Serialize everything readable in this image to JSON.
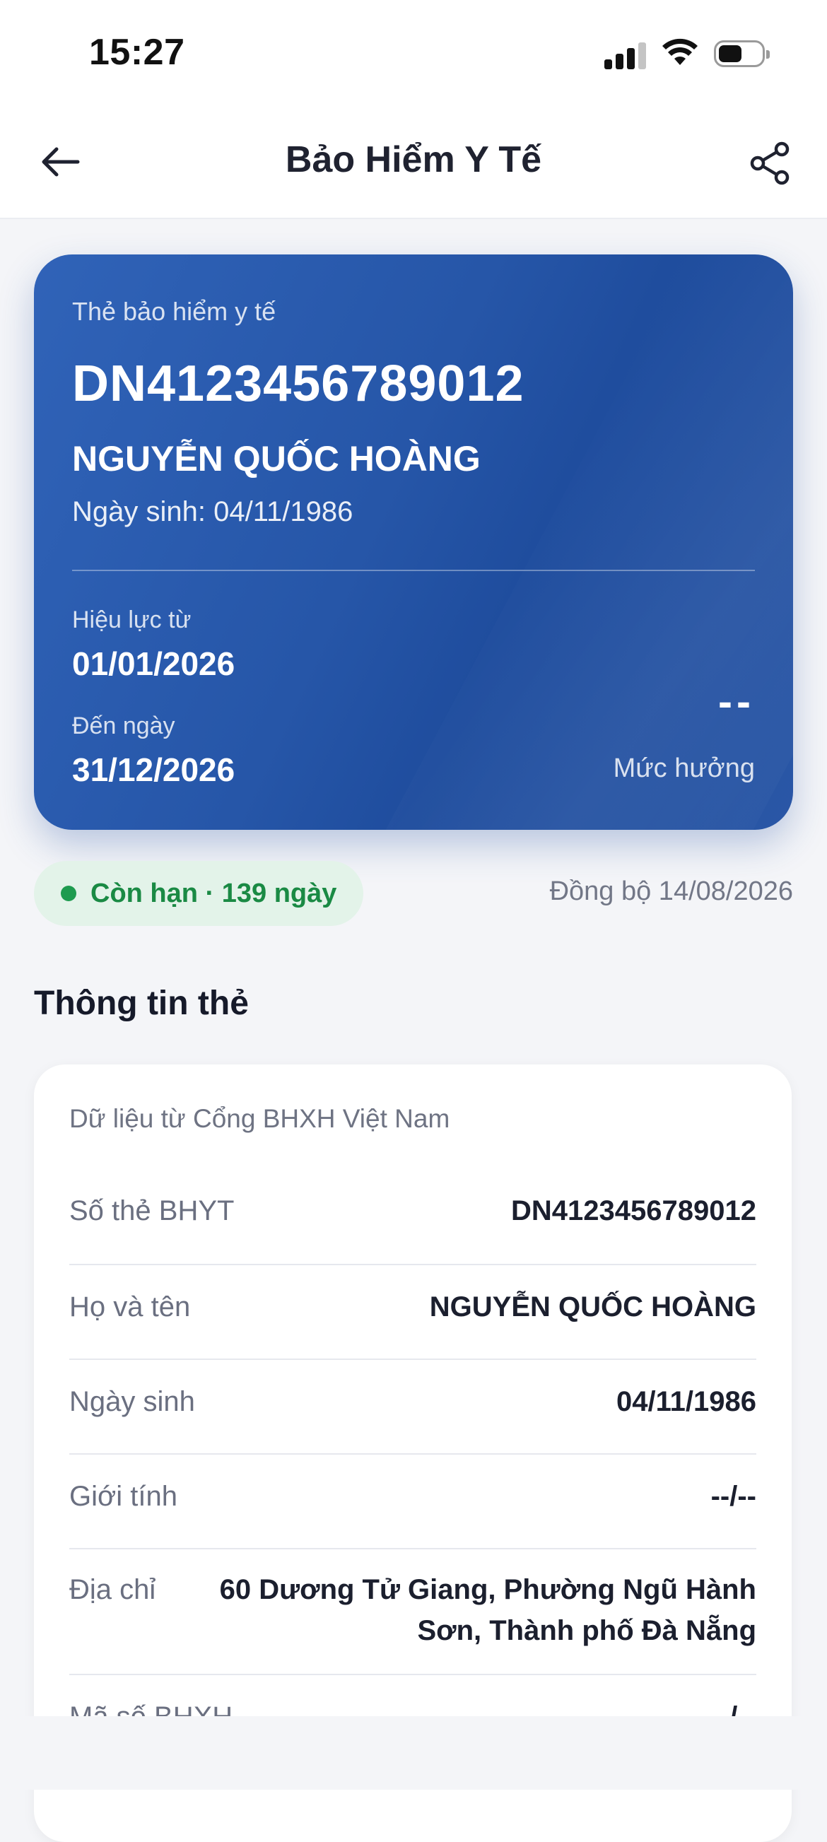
{
  "status_bar": {
    "time": "15:27"
  },
  "header": {
    "title": "Bảo Hiểm Y Tế"
  },
  "card": {
    "label": "Thẻ bảo hiểm y tế",
    "number": "DN4123456789012",
    "name": "NGUYỄN QUỐC HOÀNG",
    "dob_label": "Ngày sinh:",
    "dob": "04/11/1986",
    "valid_from_label": "Hiệu lực từ",
    "valid_from": "01/01/2026",
    "valid_to_label": "Đến ngày",
    "valid_to": "31/12/2026",
    "benefit_value": "--",
    "benefit_label": "Mức hưởng"
  },
  "status": {
    "text": "Còn hạn · 139 ngày",
    "sync": "Đồng bộ 14/08/2026",
    "color": "#1e9b4f"
  },
  "section": {
    "title": "Thông tin thẻ",
    "source": "Dữ liệu từ Cổng BHXH Việt Nam",
    "rows": [
      {
        "label": "Số thẻ BHYT",
        "value": "DN4123456789012"
      },
      {
        "label": "Họ và tên",
        "value": "NGUYỄN QUỐC HOÀNG"
      },
      {
        "label": "Ngày sinh",
        "value": "04/11/1986"
      },
      {
        "label": "Giới tính",
        "value": "--/--"
      },
      {
        "label": "Địa chỉ",
        "value": "60 Dương Tử Giang, Phường Ngũ Hành Sơn, Thành phố Đà Nẵng"
      },
      {
        "label": "Mã số BHXH",
        "value": "--/--"
      }
    ]
  },
  "colors": {
    "card_blue": "#2656a8",
    "accent_green": "#1e9b4f"
  }
}
